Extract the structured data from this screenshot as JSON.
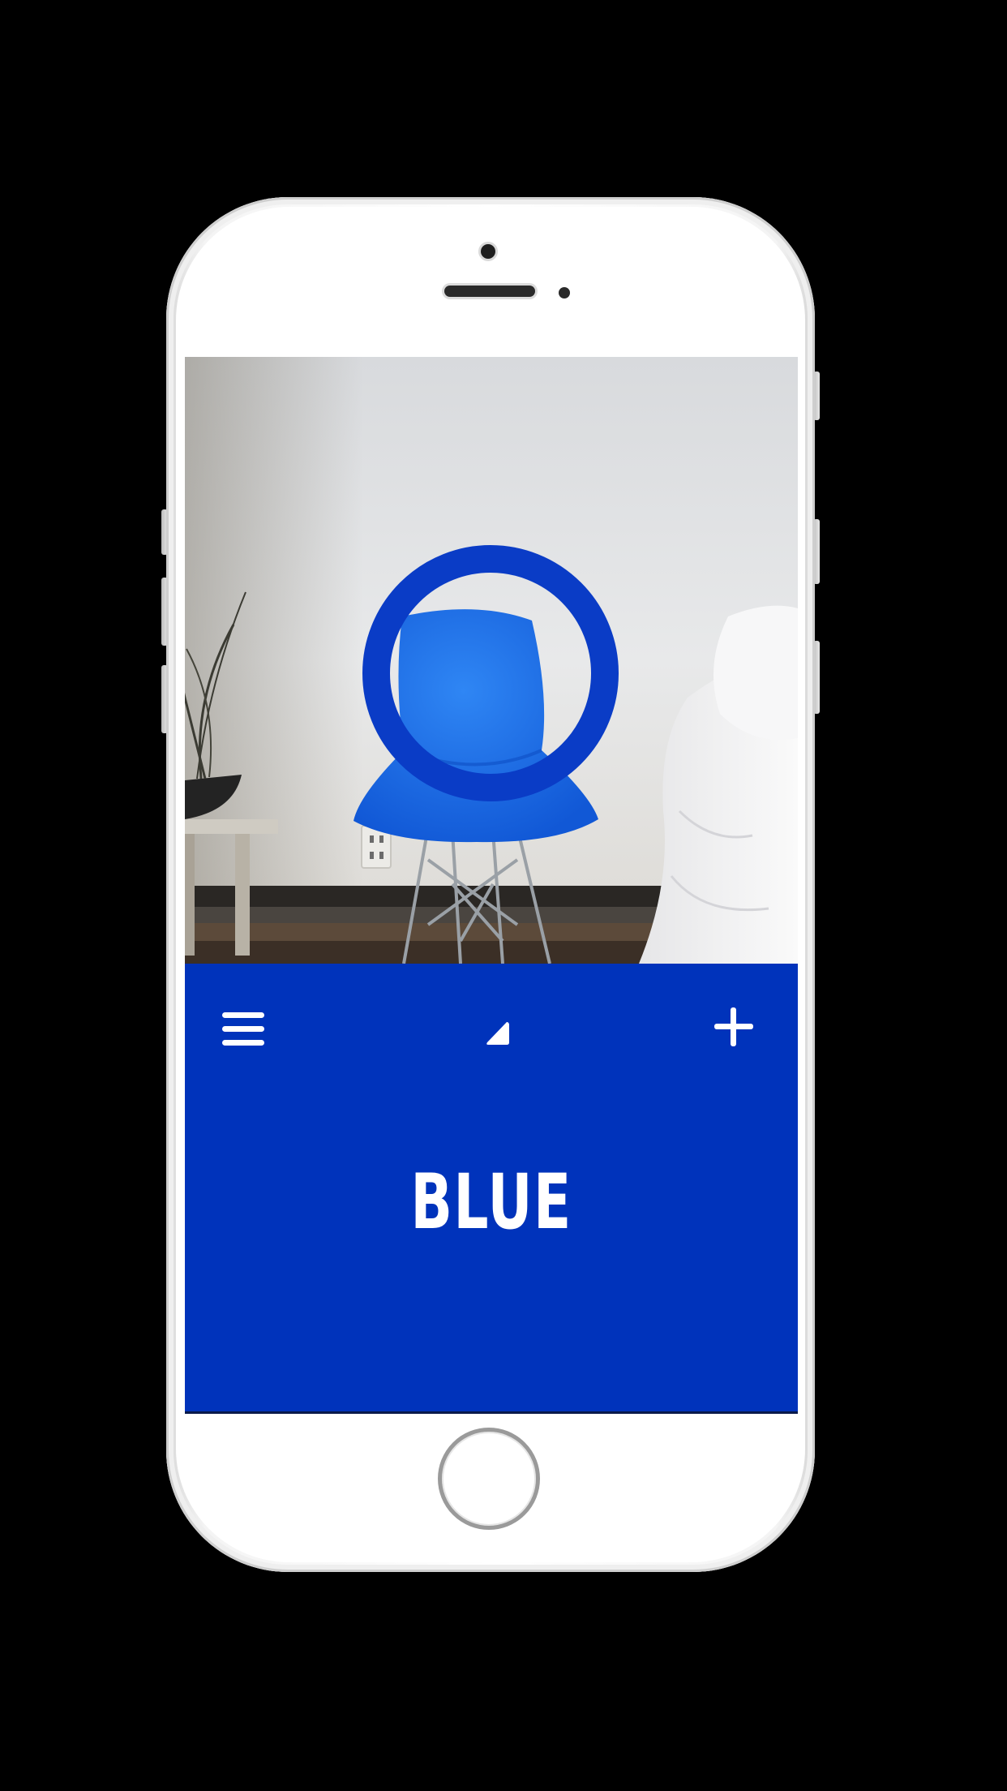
{
  "colors": {
    "accent": "#0033bb",
    "chair": "#1e6fe6",
    "ring": "#0a3cc6"
  },
  "icons": {
    "menu": "hamburger-menu-icon",
    "center": "wedge-icon",
    "add": "plus-icon",
    "picker": "ring-picker"
  },
  "color_result": {
    "name": "BLUE"
  }
}
